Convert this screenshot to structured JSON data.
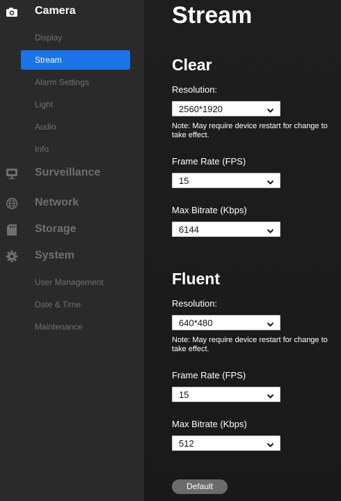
{
  "sidebar": {
    "sections": [
      {
        "label": "Camera",
        "icon": "camera-icon"
      },
      {
        "label": "Surveillance",
        "icon": "monitor-icon"
      },
      {
        "label": "Network",
        "icon": "globe-icon"
      },
      {
        "label": "Storage",
        "icon": "sd-card-icon"
      },
      {
        "label": "System",
        "icon": "gear-icon"
      }
    ],
    "camera_items": [
      "Display",
      "Stream",
      "Alarm Settings",
      "Light",
      "Audio",
      "Info"
    ],
    "system_items": [
      "User Management",
      "Date & Time",
      "Maintenance"
    ],
    "selected_item": "Stream",
    "accent_color": "#1a73e8"
  },
  "main": {
    "title": "Stream",
    "groups": [
      {
        "title": "Clear",
        "resolution_label": "Resolution:",
        "resolution_value": "2560*1920",
        "note": "Note: May require device restart for change to take effect.",
        "frame_rate_label": "Frame Rate (FPS)",
        "frame_rate_value": "15",
        "bitrate_label": "Max Bitrate (Kbps)",
        "bitrate_value": "6144"
      },
      {
        "title": "Fluent",
        "resolution_label": "Resolution:",
        "resolution_value": "640*480",
        "note": "Note: May require device restart for change to take effect.",
        "frame_rate_label": "Frame Rate (FPS)",
        "frame_rate_value": "15",
        "bitrate_label": "Max Bitrate (Kbps)",
        "bitrate_value": "512"
      }
    ],
    "default_button": "Default"
  }
}
